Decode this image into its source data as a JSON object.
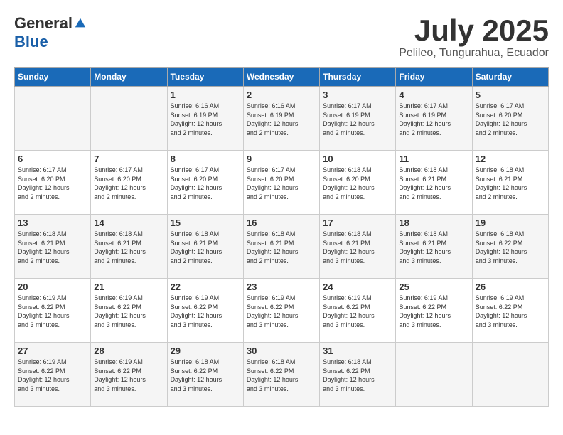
{
  "header": {
    "logo_general": "General",
    "logo_blue": "Blue",
    "month": "July 2025",
    "location": "Pelileo, Tungurahua, Ecuador"
  },
  "weekdays": [
    "Sunday",
    "Monday",
    "Tuesday",
    "Wednesday",
    "Thursday",
    "Friday",
    "Saturday"
  ],
  "weeks": [
    [
      {
        "day": "",
        "info": ""
      },
      {
        "day": "",
        "info": ""
      },
      {
        "day": "1",
        "info": "Sunrise: 6:16 AM\nSunset: 6:19 PM\nDaylight: 12 hours\nand 2 minutes."
      },
      {
        "day": "2",
        "info": "Sunrise: 6:16 AM\nSunset: 6:19 PM\nDaylight: 12 hours\nand 2 minutes."
      },
      {
        "day": "3",
        "info": "Sunrise: 6:17 AM\nSunset: 6:19 PM\nDaylight: 12 hours\nand 2 minutes."
      },
      {
        "day": "4",
        "info": "Sunrise: 6:17 AM\nSunset: 6:19 PM\nDaylight: 12 hours\nand 2 minutes."
      },
      {
        "day": "5",
        "info": "Sunrise: 6:17 AM\nSunset: 6:20 PM\nDaylight: 12 hours\nand 2 minutes."
      }
    ],
    [
      {
        "day": "6",
        "info": "Sunrise: 6:17 AM\nSunset: 6:20 PM\nDaylight: 12 hours\nand 2 minutes."
      },
      {
        "day": "7",
        "info": "Sunrise: 6:17 AM\nSunset: 6:20 PM\nDaylight: 12 hours\nand 2 minutes."
      },
      {
        "day": "8",
        "info": "Sunrise: 6:17 AM\nSunset: 6:20 PM\nDaylight: 12 hours\nand 2 minutes."
      },
      {
        "day": "9",
        "info": "Sunrise: 6:17 AM\nSunset: 6:20 PM\nDaylight: 12 hours\nand 2 minutes."
      },
      {
        "day": "10",
        "info": "Sunrise: 6:18 AM\nSunset: 6:20 PM\nDaylight: 12 hours\nand 2 minutes."
      },
      {
        "day": "11",
        "info": "Sunrise: 6:18 AM\nSunset: 6:21 PM\nDaylight: 12 hours\nand 2 minutes."
      },
      {
        "day": "12",
        "info": "Sunrise: 6:18 AM\nSunset: 6:21 PM\nDaylight: 12 hours\nand 2 minutes."
      }
    ],
    [
      {
        "day": "13",
        "info": "Sunrise: 6:18 AM\nSunset: 6:21 PM\nDaylight: 12 hours\nand 2 minutes."
      },
      {
        "day": "14",
        "info": "Sunrise: 6:18 AM\nSunset: 6:21 PM\nDaylight: 12 hours\nand 2 minutes."
      },
      {
        "day": "15",
        "info": "Sunrise: 6:18 AM\nSunset: 6:21 PM\nDaylight: 12 hours\nand 2 minutes."
      },
      {
        "day": "16",
        "info": "Sunrise: 6:18 AM\nSunset: 6:21 PM\nDaylight: 12 hours\nand 2 minutes."
      },
      {
        "day": "17",
        "info": "Sunrise: 6:18 AM\nSunset: 6:21 PM\nDaylight: 12 hours\nand 3 minutes."
      },
      {
        "day": "18",
        "info": "Sunrise: 6:18 AM\nSunset: 6:21 PM\nDaylight: 12 hours\nand 3 minutes."
      },
      {
        "day": "19",
        "info": "Sunrise: 6:18 AM\nSunset: 6:22 PM\nDaylight: 12 hours\nand 3 minutes."
      }
    ],
    [
      {
        "day": "20",
        "info": "Sunrise: 6:19 AM\nSunset: 6:22 PM\nDaylight: 12 hours\nand 3 minutes."
      },
      {
        "day": "21",
        "info": "Sunrise: 6:19 AM\nSunset: 6:22 PM\nDaylight: 12 hours\nand 3 minutes."
      },
      {
        "day": "22",
        "info": "Sunrise: 6:19 AM\nSunset: 6:22 PM\nDaylight: 12 hours\nand 3 minutes."
      },
      {
        "day": "23",
        "info": "Sunrise: 6:19 AM\nSunset: 6:22 PM\nDaylight: 12 hours\nand 3 minutes."
      },
      {
        "day": "24",
        "info": "Sunrise: 6:19 AM\nSunset: 6:22 PM\nDaylight: 12 hours\nand 3 minutes."
      },
      {
        "day": "25",
        "info": "Sunrise: 6:19 AM\nSunset: 6:22 PM\nDaylight: 12 hours\nand 3 minutes."
      },
      {
        "day": "26",
        "info": "Sunrise: 6:19 AM\nSunset: 6:22 PM\nDaylight: 12 hours\nand 3 minutes."
      }
    ],
    [
      {
        "day": "27",
        "info": "Sunrise: 6:19 AM\nSunset: 6:22 PM\nDaylight: 12 hours\nand 3 minutes."
      },
      {
        "day": "28",
        "info": "Sunrise: 6:19 AM\nSunset: 6:22 PM\nDaylight: 12 hours\nand 3 minutes."
      },
      {
        "day": "29",
        "info": "Sunrise: 6:18 AM\nSunset: 6:22 PM\nDaylight: 12 hours\nand 3 minutes."
      },
      {
        "day": "30",
        "info": "Sunrise: 6:18 AM\nSunset: 6:22 PM\nDaylight: 12 hours\nand 3 minutes."
      },
      {
        "day": "31",
        "info": "Sunrise: 6:18 AM\nSunset: 6:22 PM\nDaylight: 12 hours\nand 3 minutes."
      },
      {
        "day": "",
        "info": ""
      },
      {
        "day": "",
        "info": ""
      }
    ]
  ]
}
